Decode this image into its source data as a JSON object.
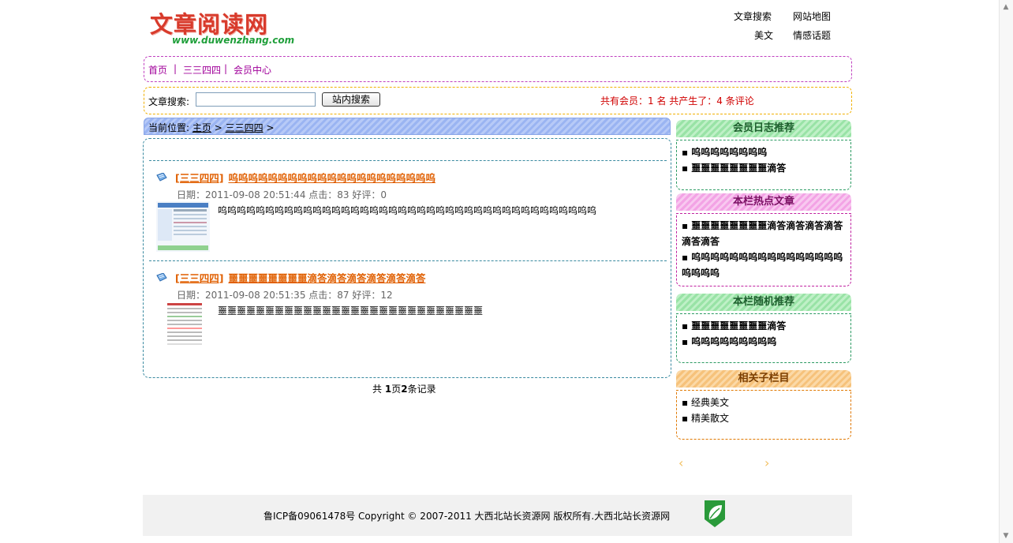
{
  "logo": {
    "name_cn": "文章阅读网",
    "url_text": "www.duwenzhang.com"
  },
  "top_links": [
    "文章搜索",
    "网站地图",
    "美文",
    "情感话题"
  ],
  "nav": {
    "home": "首页",
    "sep1": "|",
    "cat": "三三四四",
    "sep2": "|",
    "member": "会员中心"
  },
  "search": {
    "label": "文章搜索:",
    "value": "",
    "button": "站内搜索",
    "stats": "共有会员：1 名 共产生了：4 条评论"
  },
  "breadcrumb": {
    "prefix": "当前位置:",
    "home": "主页",
    "arrow1": ">",
    "cat": "三三四四",
    "arrow2": ">"
  },
  "articles": [
    {
      "category": "[三三四四]",
      "title": "呜呜呜呜呜呜呜呜呜呜呜呜呜呜呜呜呜呜呜呜呜",
      "meta": "日期：2011-09-08 20:51:44 点击：83 好评：0",
      "excerpt": "呜呜呜呜呜呜呜呜呜呜呜呜呜呜呜呜呜呜呜呜呜呜呜呜呜呜呜呜呜呜呜呜呜呜呜呜呜呜呜呜"
    },
    {
      "category": "[三三四四]",
      "title": "噩噩噩噩噩噩噩噩滴答滴答滴答滴答滴答滴答",
      "meta": "日期：2011-09-08 20:51:35 点击：87 好评：12",
      "excerpt": "噩噩噩噩噩噩噩噩噩噩噩噩噩噩噩噩噩噩噩噩噩噩噩噩噩噩噩噩"
    }
  ],
  "pager": {
    "pre": "共 ",
    "pages": "1",
    "mid": "页",
    "count": "2",
    "post": "条记录"
  },
  "sidebar": {
    "member_blog": {
      "title": "会员日志推荐",
      "items": [
        "▪ 呜呜呜呜呜呜呜呜",
        "▪ 噩噩噩噩噩噩噩噩滴答"
      ]
    },
    "hot": {
      "title": "本栏热点文章",
      "items": [
        "▪ 噩噩噩噩噩噩噩噩滴答滴答滴答滴答滴答滴答",
        "▪ 呜呜呜呜呜呜呜呜呜呜呜呜呜呜呜呜呜呜呜呜"
      ]
    },
    "random": {
      "title": "本栏随机推荐",
      "items": [
        "▪ 噩噩噩噩噩噩噩噩滴答",
        "▪ 呜呜呜呜呜呜呜呜呜"
      ]
    },
    "sub": {
      "title": "相关子栏目",
      "items": [
        "▪ 经典美文",
        "▪ 精美散文"
      ]
    },
    "arrows": {
      "left": "‹",
      "right": "›"
    }
  },
  "footer": {
    "text": "鲁ICP备09061478号 Copyright © 2007-2011 大西北站长资源网 版权所有.大西北站长资源网"
  },
  "colors": {
    "nav_border": "#c040c0",
    "search_border": "#f0b000",
    "article_title": "#e05f00",
    "stats": "#d00000"
  }
}
